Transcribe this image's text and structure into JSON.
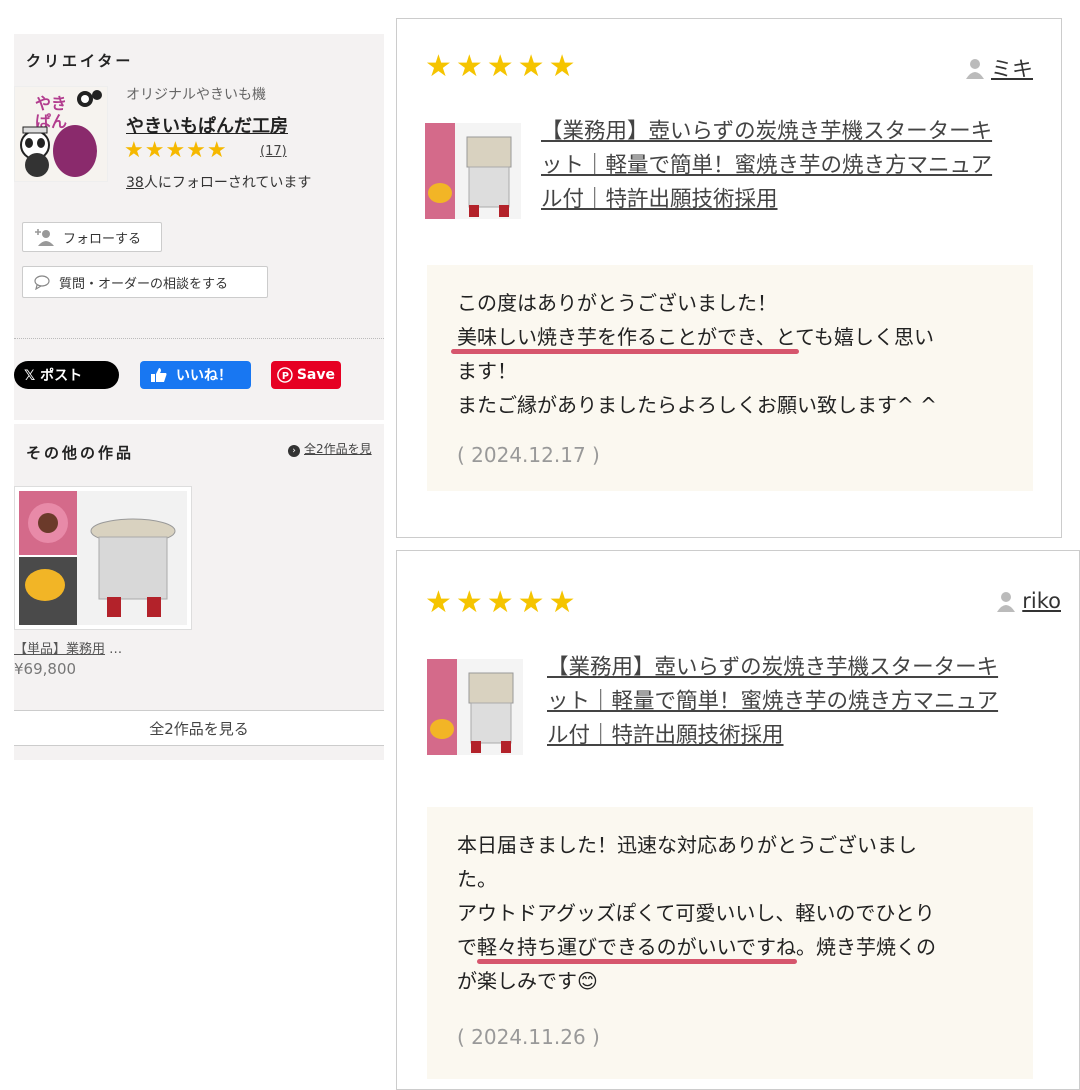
{
  "creator": {
    "section_title": "クリエイター",
    "subtitle": "オリジナルやきいも機",
    "name": "やきいもぱんだ工房",
    "rating_stars": "★★★★★",
    "review_count": "(17)",
    "followers_number": "38",
    "followers_suffix": "人にフォローされています",
    "follow_label": "フォローする",
    "inquiry_label": "質問・オーダーの相談をする",
    "logo_text": "やきいも ぱんだ 工房"
  },
  "share": {
    "x_label": "𝕏 ポスト",
    "like_label": "いいね！",
    "pinterest_label": "Save"
  },
  "other_works": {
    "section_title": "その他の作品",
    "see_all_link": "全2作品を見",
    "item_title": "【単品】業務用",
    "item_ellipsis": "…",
    "item_price": "¥69,800",
    "see_all_button": "全2作品を見る"
  },
  "reviews": [
    {
      "stars": "★★★★★",
      "reviewer": "ミキ",
      "product_lines": [
        "【業務用】壺いらずの炭焼き芋機スターターキ",
        "ット｜軽量で簡単！蜜焼き芋の焼き方マニュア",
        "ル付｜特許出願技術採用"
      ],
      "message_lines": [
        "この度はありがとうございました！",
        "美味しい焼き芋を作ることができ、とても嬉しく思い",
        "ます！",
        "またご縁がありましたらよろしくお願い致します^ ^"
      ],
      "date": "( 2024.12.17 )"
    },
    {
      "stars": "★★★★★",
      "reviewer": "riko",
      "product_lines": [
        "【業務用】壺いらずの炭焼き芋機スターターキ",
        "ット｜軽量で簡単！蜜焼き芋の焼き方マニュア",
        "ル付｜特許出願技術採用"
      ],
      "message_lines": [
        "本日届きました！迅速な対応ありがとうございまし",
        "た。",
        "アウトドアグッズぽくて可愛いいし、軽いのでひとり",
        "で軽々持ち運びできるのがいいですね。焼き芋焼くの",
        "が楽しみです😊"
      ],
      "date": "( 2024.11.26 )"
    }
  ],
  "colors": {
    "star": "#f5c400",
    "highlight_underline": "#d6566d",
    "message_bg": "#fbf8f0",
    "panel_bg": "#f4f2f2",
    "facebook": "#1877f2",
    "pinterest": "#e60023"
  },
  "icons": [
    "user-icon",
    "add-user-icon",
    "speech-bubble-icon",
    "circle-arrow-icon",
    "thumbs-up-icon",
    "pinterest-icon"
  ]
}
